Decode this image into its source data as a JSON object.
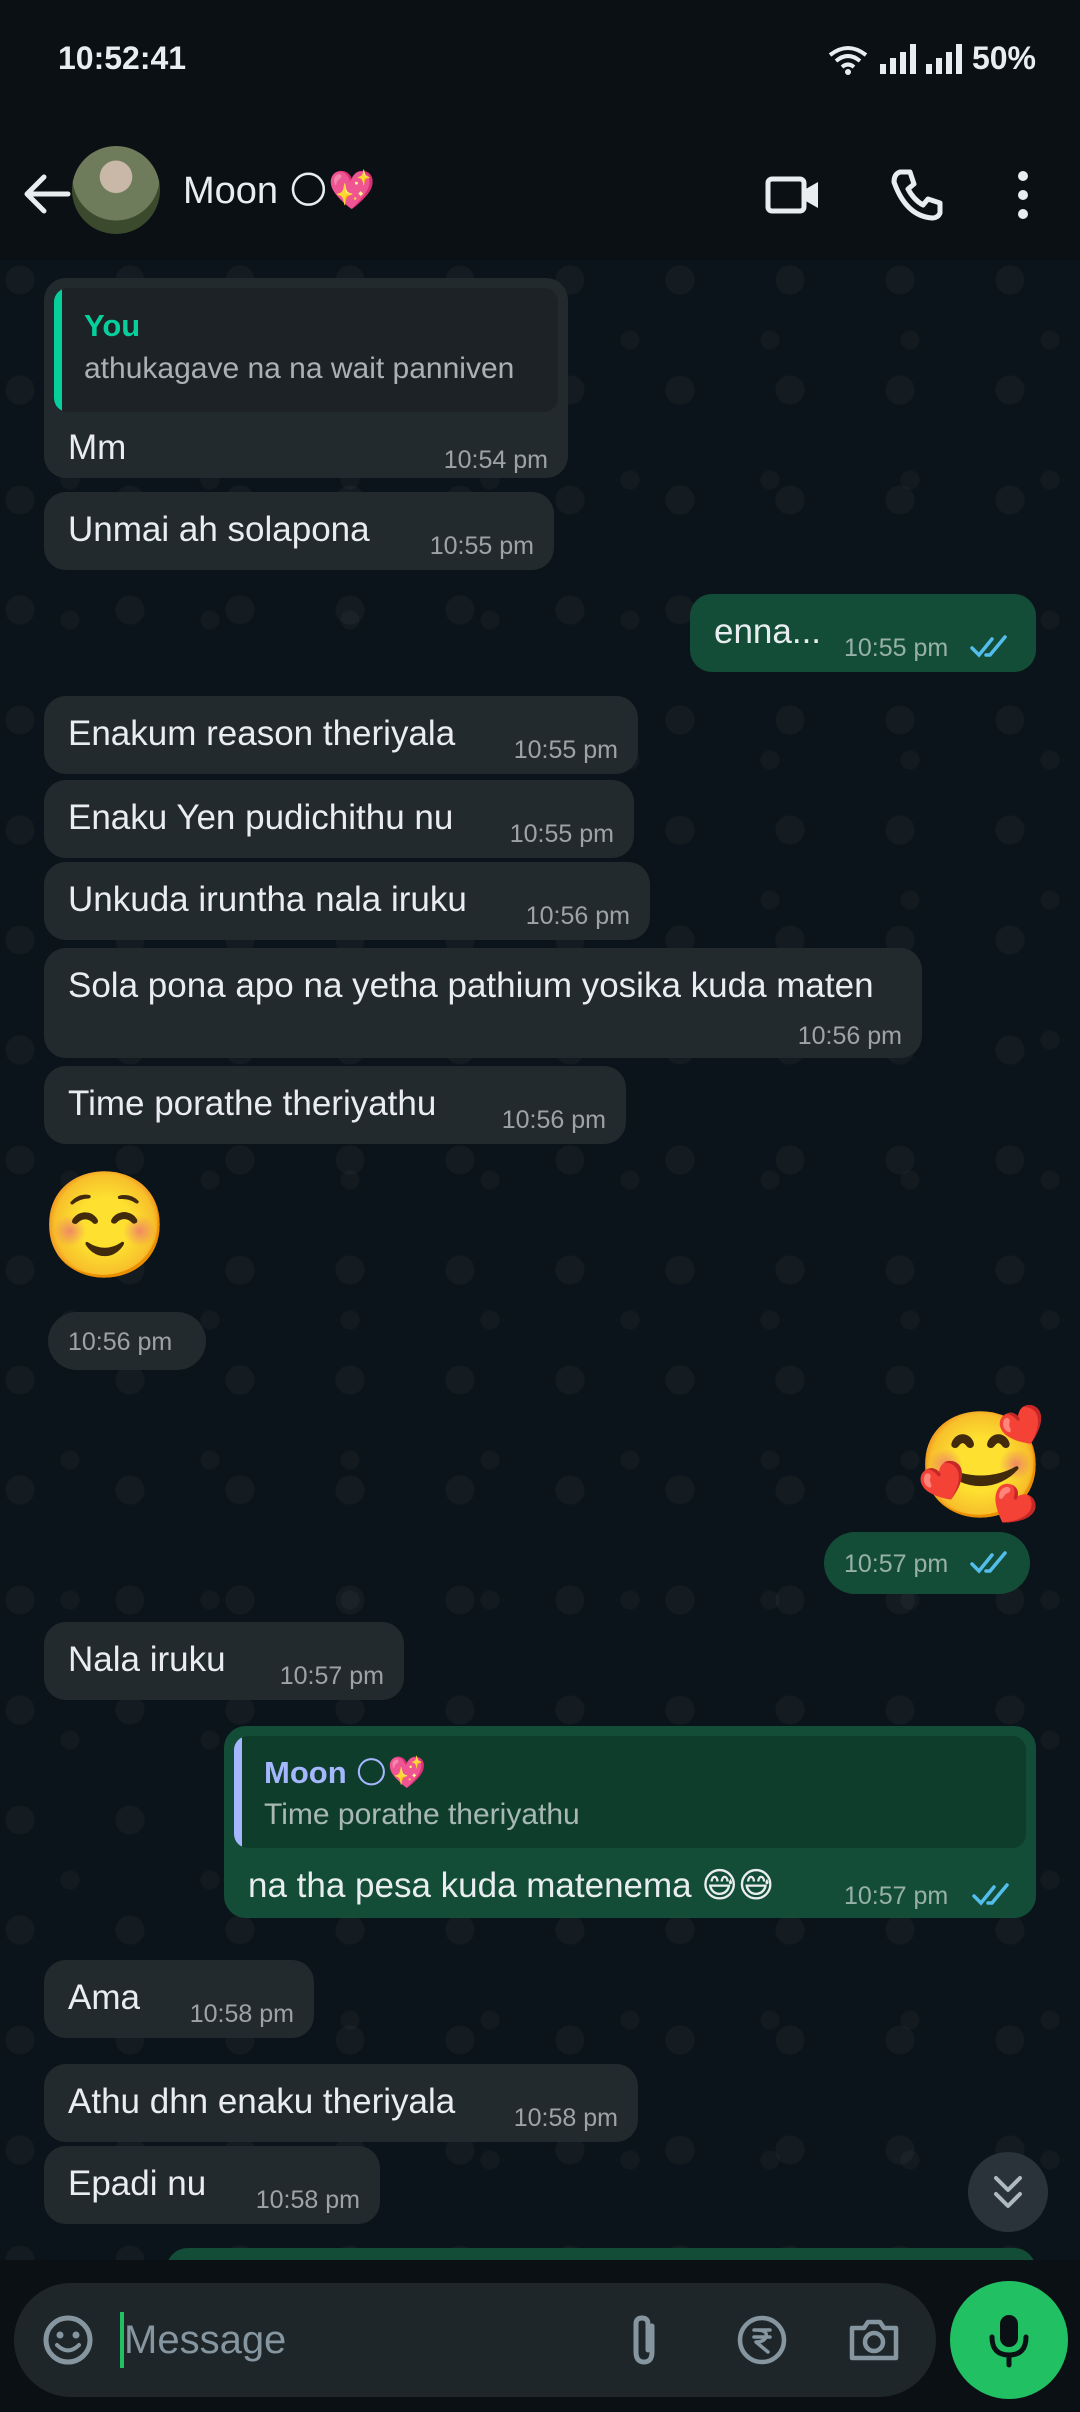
{
  "status_bar": {
    "time": "10:52:41",
    "battery": "50%"
  },
  "header": {
    "contact_name": "Moon",
    "contact_emojis": "🌕💖"
  },
  "messages": [
    {
      "dir": "in",
      "quote_author": "You",
      "quote_text": "athukagave na na wait panniven",
      "text": "Mm",
      "time": "10:54 pm"
    },
    {
      "dir": "in",
      "text": "Unmai ah solapona",
      "time": "10:55 pm"
    },
    {
      "dir": "out",
      "text": "enna...",
      "time": "10:55 pm"
    },
    {
      "dir": "in",
      "text": "Enakum reason theriyala",
      "time": "10:55 pm"
    },
    {
      "dir": "in",
      "text": "Enaku Yen pudichithu nu",
      "time": "10:55 pm"
    },
    {
      "dir": "in",
      "text": "Unkuda iruntha nala iruku",
      "time": "10:56 pm"
    },
    {
      "dir": "in",
      "text": "Sola pona apo na yetha pathium yosika kuda maten",
      "time": "10:56 pm"
    },
    {
      "dir": "in",
      "text": "Time porathe theriyathu",
      "time": "10:56 pm"
    },
    {
      "dir": "in",
      "emoji": "☺️",
      "time": "10:56 pm"
    },
    {
      "dir": "out",
      "emoji": "🥰",
      "time": "10:57 pm"
    },
    {
      "dir": "in",
      "text": "Nala iruku",
      "time": "10:57 pm"
    },
    {
      "dir": "out",
      "quote_author": "Moon 🌕💖",
      "quote_text": "Time porathe theriyathu",
      "text": "na tha pesa kuda matenema 😅😅",
      "time": "10:57 pm"
    },
    {
      "dir": "in",
      "text": "Ama",
      "time": "10:58 pm"
    },
    {
      "dir": "in",
      "text": "Athu dhn enaku theriyala",
      "time": "10:58 pm"
    },
    {
      "dir": "in",
      "text": "Epadi nu",
      "time": "10:58 pm"
    }
  ],
  "composer": {
    "placeholder": "Message"
  },
  "colors": {
    "background": "#0b141a",
    "incoming_bubble": "#232a2e",
    "outgoing_bubble": "#144d37",
    "accent_green": "#21c063",
    "read_ticks": "#53bdeb",
    "quote_you": "#06cf9c",
    "quote_moon": "#a5b7ff"
  },
  "icons": [
    "back-arrow-icon",
    "video-call-icon",
    "phone-icon",
    "more-vert-icon",
    "double-check-icon",
    "scroll-down-icon",
    "emoji-icon",
    "attach-icon",
    "rupee-icon",
    "camera-icon",
    "mic-icon"
  ]
}
